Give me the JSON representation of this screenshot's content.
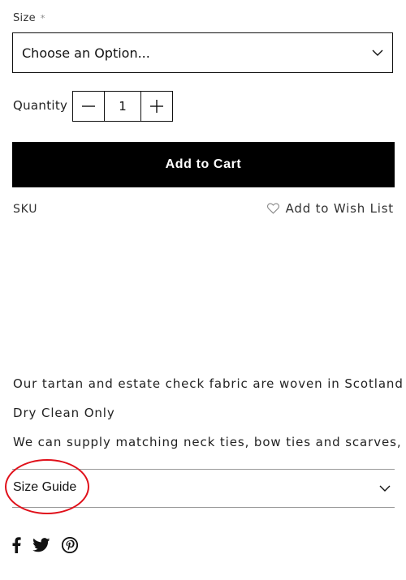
{
  "product_options": {
    "size_label": "Size",
    "required_marker": "*",
    "size_select_value": "Choose an Option..."
  },
  "quantity": {
    "label": "Quantity",
    "value": "1"
  },
  "add_to_cart_label": "Add to Cart",
  "sku_label": "SKU",
  "wishlist_label": "Add to Wish List",
  "description": [
    "Our tartan and estate check fabric are woven in Scotland",
    "Dry Clean Only",
    "We can supply matching neck ties, bow ties and scarves,"
  ],
  "accordion": {
    "size_guide_label": "Size Guide"
  },
  "social_icons": [
    "facebook-icon",
    "twitter-icon",
    "pinterest-icon"
  ],
  "colors": {
    "button_bg": "#000000",
    "button_text": "#ffffff",
    "highlight_circle": "#e0101a"
  }
}
